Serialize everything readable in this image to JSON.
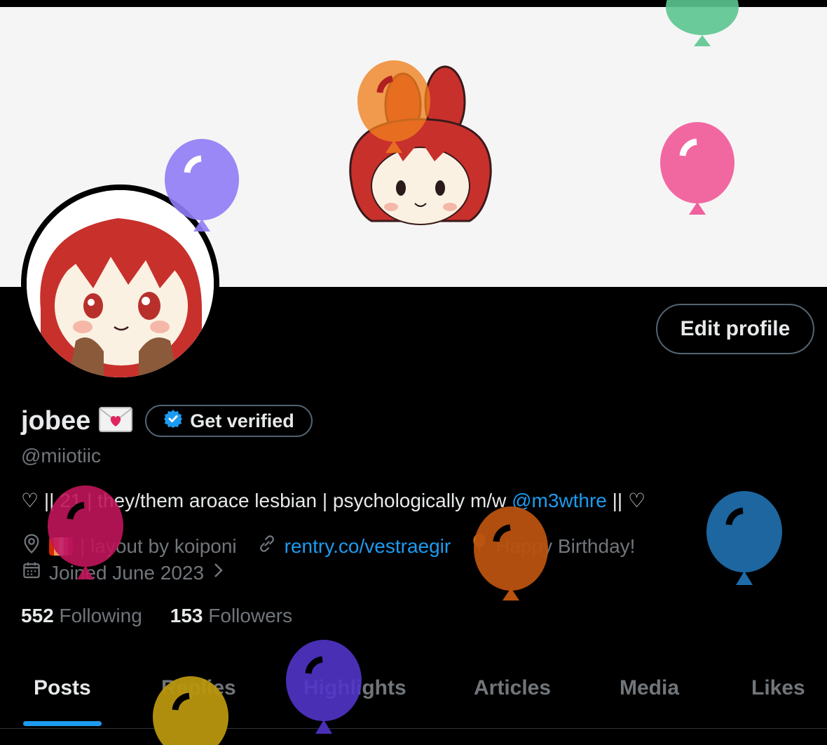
{
  "profile": {
    "display_name": "jobee",
    "handle": "@miiotiic",
    "edit_label": "Edit profile",
    "verify_label": "Get verified"
  },
  "bio": {
    "start": "♡ || 21 | they/them aroace lesbian | psychologically m/w ",
    "mention": "@m3wthre",
    "end": " || ♡"
  },
  "meta": {
    "layout_credit": "| layout by koiponi",
    "website": "rentry.co/vestraegir",
    "birthday": "Happy Birthday!",
    "joined": "Joined June 2023"
  },
  "stats": {
    "following_count": "552",
    "following_label": "Following",
    "followers_count": "153",
    "followers_label": "Followers"
  },
  "tabs": [
    "Posts",
    "Replies",
    "Highlights",
    "Articles",
    "Media",
    "Likes"
  ],
  "colors": {
    "accent": "#1d9bf0",
    "muted": "#71767b",
    "text": "#e7e9ea",
    "border": "#536471"
  }
}
